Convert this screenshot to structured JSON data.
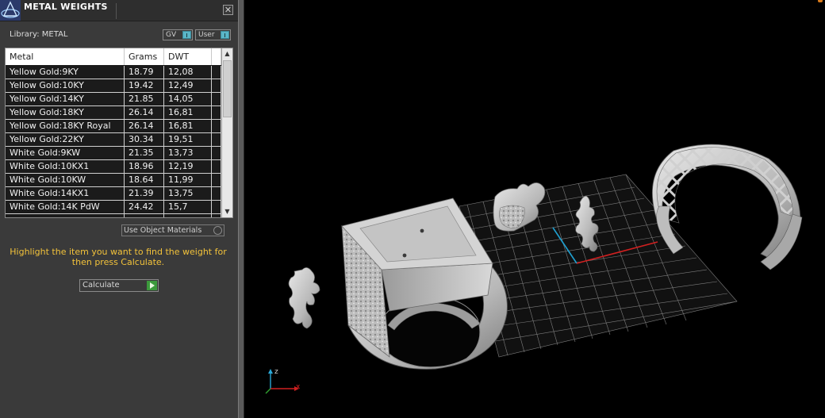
{
  "panel": {
    "title": "METAL WEIGHTS",
    "close_symbol": "✕",
    "library_label": "Library: METAL",
    "toggles": [
      {
        "label": "GV"
      },
      {
        "label": "User"
      }
    ],
    "columns": [
      "Metal",
      "Grams",
      "DWT"
    ],
    "rows": [
      {
        "metal": "Yellow Gold:9KY",
        "grams": "18.79",
        "dwt": "12,08"
      },
      {
        "metal": "Yellow Gold:10KY",
        "grams": "19.42",
        "dwt": "12,49"
      },
      {
        "metal": "Yellow Gold:14KY",
        "grams": "21.85",
        "dwt": "14,05"
      },
      {
        "metal": "Yellow Gold:18KY",
        "grams": "26.14",
        "dwt": "16,81"
      },
      {
        "metal": "Yellow Gold:18KY Royal",
        "grams": "26.14",
        "dwt": "16,81"
      },
      {
        "metal": "Yellow Gold:22KY",
        "grams": "30.34",
        "dwt": "19,51"
      },
      {
        "metal": "White Gold:9KW",
        "grams": "21.35",
        "dwt": "13,73"
      },
      {
        "metal": "White Gold:10KX1",
        "grams": "18.96",
        "dwt": "12,19"
      },
      {
        "metal": "White Gold:10KW",
        "grams": "18.64",
        "dwt": "11,99"
      },
      {
        "metal": "White Gold:14KX1",
        "grams": "21.39",
        "dwt": "13,75"
      },
      {
        "metal": "White Gold:14K PdW",
        "grams": "24.42",
        "dwt": "15,7"
      }
    ],
    "use_object_materials": "Use Object Materials",
    "hint": "Highlight the item you want to find the weight for then press Calculate.",
    "calculate_label": "Calculate"
  },
  "viewport": {
    "axis_labels": {
      "z": "z",
      "x": "x"
    },
    "colors": {
      "grid": "#8a8a8a",
      "x_axis": "#d02020",
      "y_axis": "#20a0d0",
      "model": "#c8c8c8"
    }
  }
}
